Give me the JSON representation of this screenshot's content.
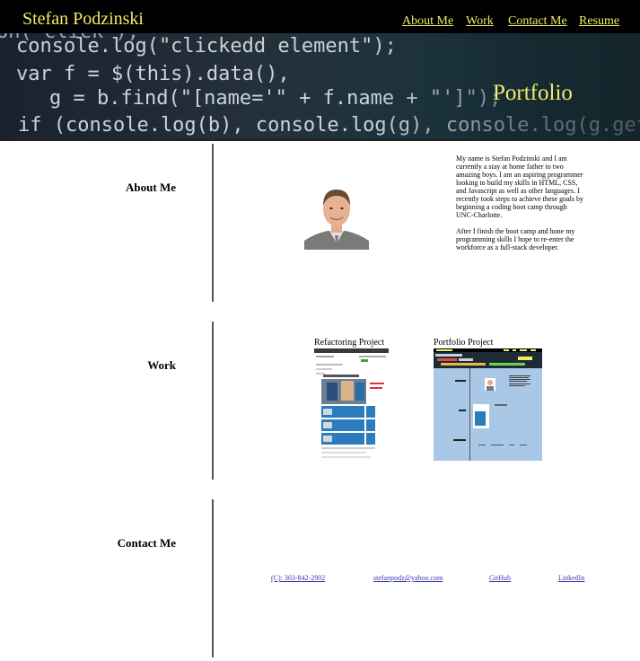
{
  "header": {
    "brand": "Stefan Podzinski",
    "nav": [
      {
        "label": "About Me"
      },
      {
        "label": "Work"
      },
      {
        "label": "Contact Me"
      },
      {
        "label": "Resume"
      }
    ]
  },
  "hero": {
    "title": "Portfolio",
    "code_lines": [
      "on( click ), ",
      "console.log(\"clickedd element\");",
      "var f = $(this).data(),",
      "g = b.find(\"[name='\" + f.name + \"']\");",
      "if (console.log(b), console.log(g), console.log(g.get"
    ]
  },
  "about": {
    "heading": "About Me",
    "avatar_icon": "profile-photo",
    "paragraph1": "My name is Stefan Podzinski and I am currently a stay at home father to two amazing boys. I am an aspiring programmer looking to build my skills in HTML, CSS, and Javascript as well as other languages. I recently took steps to achieve these goals by beginning a coding boot camp through UNC-Charlotte.",
    "paragraph2": "After I finish the boot camp and hone my programming skills I hope to re-enter the workforce as a full-stack developer."
  },
  "work": {
    "heading": "Work",
    "projects": [
      {
        "title": "Refactoring Project"
      },
      {
        "title": "Portfolio Project"
      }
    ]
  },
  "contact": {
    "heading": "Contact Me",
    "links": [
      {
        "label": "(C): 303-842-2902"
      },
      {
        "label": "stefanpodz@yahoo.com"
      },
      {
        "label": "GitHub"
      },
      {
        "label": "LinkedIn"
      }
    ]
  },
  "colors": {
    "accent": "#f1ec6a",
    "header_bg": "#000000",
    "link": "#3b3bb0",
    "portfolio_thumb_bg": "#a9c7e6"
  }
}
